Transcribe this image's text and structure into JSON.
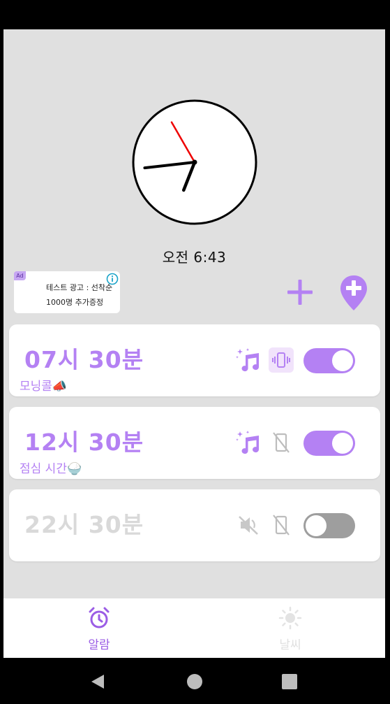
{
  "clock": {
    "time_text": "오전 6:43",
    "hour": 6,
    "minute": 43,
    "second": 55
  },
  "ad": {
    "badge": "Ad",
    "line1": "테스트 광고 : 선착순",
    "line2": "1000명 추가증정"
  },
  "actions": {
    "add_icon": "plus-icon",
    "add_location_icon": "location-plus-icon"
  },
  "alarms": [
    {
      "time": "07시 30분",
      "label": "모닝콜📣",
      "sound": "on",
      "vibrate": "on",
      "enabled": true
    },
    {
      "time": "12시 30분",
      "label": "점심 시간🍚",
      "sound": "on",
      "vibrate": "off",
      "enabled": true
    },
    {
      "time": "22시 30분",
      "label": "",
      "sound": "off",
      "vibrate": "off",
      "enabled": false
    }
  ],
  "nav": {
    "items": [
      {
        "label": "알람",
        "icon": "alarm-clock-icon",
        "active": true
      },
      {
        "label": "날씨",
        "icon": "sun-icon",
        "active": false
      }
    ]
  },
  "colors": {
    "accent": "#b481f3",
    "background": "#e0e0e0",
    "inactive": "#d9d9d9",
    "toggle_off": "#9e9e9e"
  }
}
